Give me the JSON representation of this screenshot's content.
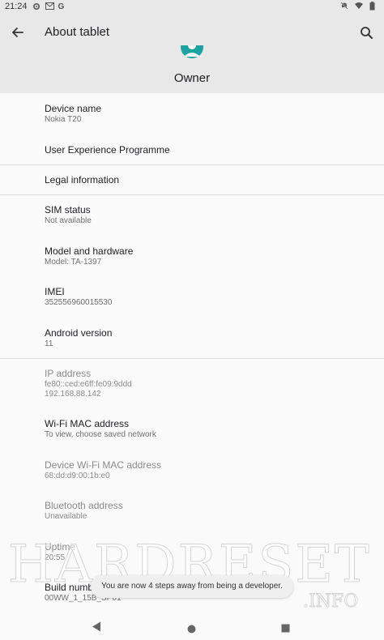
{
  "status_bar": {
    "time": "21:24",
    "left_icons": [
      "settings-icon",
      "mail-icon",
      "google-icon"
    ],
    "right_icons": [
      "notifications-off-icon",
      "wifi-icon",
      "battery-icon"
    ],
    "google_label": "G"
  },
  "toolbar": {
    "title": "About tablet",
    "back_icon": "arrow-back-icon",
    "search_icon": "search-icon"
  },
  "header": {
    "owner_name": "Owner"
  },
  "items": [
    {
      "title": "Device name",
      "subtitle": "Nokia T20"
    },
    {
      "title": "User Experience Programme",
      "subtitle": ""
    },
    {
      "title": "Legal information",
      "subtitle": ""
    },
    {
      "title": "SIM status",
      "subtitle": "Not available"
    },
    {
      "title": "Model and hardware",
      "subtitle": "Model: TA-1397"
    },
    {
      "title": "IMEI",
      "subtitle": "352556960015530"
    },
    {
      "title": "Android version",
      "subtitle": "11"
    },
    {
      "title": "IP address",
      "subtitle": "fe80::ced:e6ff:fe09:9ddd",
      "subtitle2": "192.168.88.142"
    },
    {
      "title": "Wi-Fi MAC address",
      "subtitle": "To view, choose saved network"
    },
    {
      "title": "Device Wi-Fi MAC address",
      "subtitle": "68:dd:d9:00:1b:e0"
    },
    {
      "title": "Bluetooth address",
      "subtitle": "Unavailable"
    },
    {
      "title": "Uptime",
      "subtitle": "20:55"
    },
    {
      "title": "Build number",
      "subtitle": "00WW_1_15B_SP01"
    }
  ],
  "toast": {
    "message": "You are now 4 steps away from being a developer."
  },
  "watermark": {
    "text": "HARDRESET",
    "sub": ".INFO"
  },
  "nav_bar": {
    "back_icon": "nav-back-icon",
    "home_icon": "nav-home-icon",
    "recents_icon": "nav-recents-icon"
  }
}
